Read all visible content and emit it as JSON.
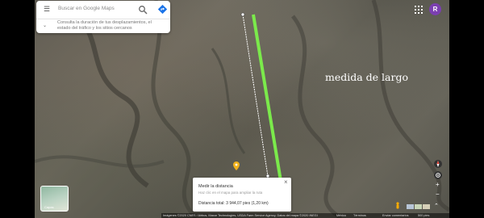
{
  "search": {
    "placeholder": "Buscar en Google Maps",
    "commute_hint": "Consulta la duración de tus desplazamientos, el estado del tráfico y los sitios cercanos"
  },
  "account": {
    "initial": "R",
    "color": "#7b3fb0"
  },
  "overlay": {
    "label": "medida de largo",
    "line_color": "#7bea4b"
  },
  "layer_thumb": {
    "label": "Capas"
  },
  "measure": {
    "title": "Medir la distancia",
    "subtitle": "Haz clic en el mapa para ampliar la ruta",
    "total": "Distancia total: 3 944,07 pies (1,20 km)",
    "close": "×"
  },
  "controls": {
    "zoom_in": "+",
    "zoom_out": "−"
  },
  "footer": {
    "attribution": "Imágenes ©2020 CNES / Airbus, Maxar Technologies, USDA Farm Service Agency, Datos del mapa ©2020 INEGI",
    "country": "México",
    "terms": "Términos",
    "feedback": "Enviar comentarios",
    "scale": "500 pies"
  }
}
